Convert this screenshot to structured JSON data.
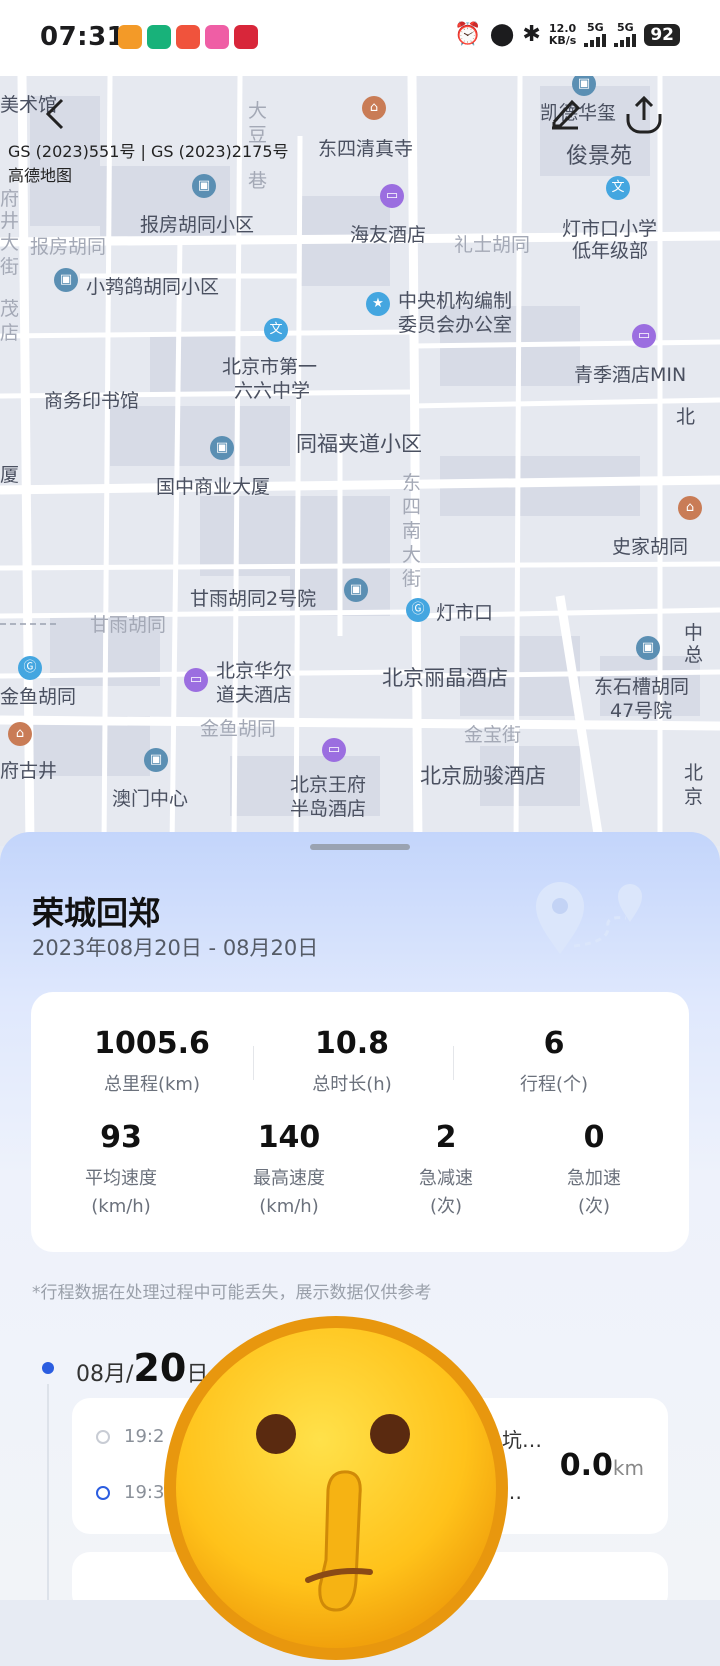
{
  "status_bar": {
    "time": "07:31",
    "net_speed_value": "12.0",
    "net_speed_unit": "KB/s",
    "sim1": "5G",
    "sim2": "5G",
    "battery": "92"
  },
  "map": {
    "copyright_line1": "GS (2023)551号 | GS (2023)2175号",
    "copyright_line2": "高德地图",
    "labels": {
      "meishuguan": "美术馆",
      "dongsi_mosque": "东四清真寺",
      "kaide": "凯德华玺",
      "junjingyuan": "俊景苑",
      "dadou": "大",
      "dadou2": "豆",
      "dadou3": "巷",
      "fuzhi": "府",
      "fuzhi2": "井",
      "fuzhi3": "大",
      "fuzhi4": "街",
      "baofang_xiaoqu": "报房胡同小区",
      "baofang_hutong": "报房胡同",
      "haiyou": "海友酒店",
      "lishi": "礼士胡同",
      "dengshikou_school": "灯市口小学",
      "dengshikou_school2": "低年级部",
      "xiaojinge": "小鹁鸽胡同小区",
      "zhongyang": "中央机构编制",
      "zhongyang2": "委员会办公室",
      "school166": "北京市第一",
      "school166_2": "六六中学",
      "qingji": "青季酒店MIN",
      "shangwu": "商务印书馆",
      "tongfu": "同福夹道小区",
      "bei": "北",
      "guozhong": "国中商业大厦",
      "dongsinan": "东",
      "dongsinan2": "四",
      "dongsinan3": "南",
      "dongsinan4": "大",
      "dongsinan5": "街",
      "shijia": "史家胡同",
      "ganyu2": "甘雨胡同2号院",
      "dengshikou": "灯市口",
      "ganyu": "甘雨胡同",
      "huaer": "北京华尔",
      "huaer2": "道夫酒店",
      "lijing": "北京丽晶酒店",
      "dongshicao": "东石槽胡同",
      "dongshicao2": "47号院",
      "jinyu_left": "金鱼胡同",
      "jinyu": "金鱼胡同",
      "jinbao": "金宝街",
      "fuguji": "府古井",
      "wangfu": "北京王府",
      "wangfu2": "半岛酒店",
      "lijun": "北京励骏酒店",
      "macau": "澳门中心",
      "xia": "厦",
      "zhong": "中",
      "zong": "总",
      "bei2": "北",
      "bei3": "京",
      "zheng": "茂",
      "dian": "店"
    }
  },
  "sheet": {
    "title": "荣城回郑",
    "date_range": "2023年08月20日  - 08月20日",
    "stats": [
      {
        "value": "1005.6",
        "label": "总里程(km)"
      },
      {
        "value": "10.8",
        "label": "总时长(h)"
      },
      {
        "value": "6",
        "label": "行程(个)"
      },
      {
        "value": "93",
        "label": "平均速度",
        "unit": "(km/h)"
      },
      {
        "value": "140",
        "label": "最高速度",
        "unit": "(km/h)"
      },
      {
        "value": "2",
        "label": "急减速",
        "unit": "(次)"
      },
      {
        "value": "0",
        "label": "急加速",
        "unit": "(次)"
      }
    ],
    "note": "*行程数据在处理过程中可能丢失，展示数据仅供参考",
    "day_month": "08月/",
    "day_num": "20",
    "day_suffix": "日",
    "trip": {
      "start_time": "19:2",
      "end_time": "19:3",
      "start_text": "坑…",
      "end_text": "…",
      "distance": "0.0",
      "distance_unit": "km"
    }
  }
}
